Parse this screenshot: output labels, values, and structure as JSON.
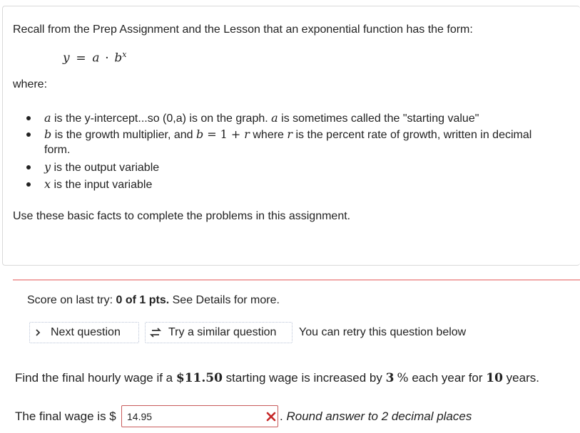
{
  "intro": {
    "recall_text": "Recall from the Prep Assignment and the Lesson that an exponential function has the form:",
    "formula": {
      "lhs": "y",
      "eq": "=",
      "a": "a",
      "dot": "·",
      "b": "b",
      "exp": "x"
    },
    "where_label": "where:",
    "bullets": [
      {
        "var": "a",
        "text": " is the y-intercept...so (0,a) is on the graph. ",
        "var2": "a",
        "text2": " is sometimes called the \"starting value\""
      },
      {
        "var": "b",
        "text": " is the growth multiplier, and ",
        "eq_b": "b",
        "eq_eq": "=",
        "eq_one": "1",
        "eq_plus": "+",
        "eq_r": "r",
        "text2": " where ",
        "r": "r",
        "text3": " is the percent rate of growth, written in decimal",
        "text4": "form."
      },
      {
        "var": "y",
        "text": " is the output variable"
      },
      {
        "var": "x",
        "text": " is the input variable"
      }
    ],
    "use_text": "Use these basic facts to complete the problems in this assignment."
  },
  "score": {
    "prefix": "Score on last try: ",
    "value": "0 of 1 pts.",
    "suffix": " See Details for more."
  },
  "buttons": {
    "next_label": "Next question",
    "similar_label": "Try a similar question",
    "retry_note": "You can retry this question below"
  },
  "question": {
    "p1": "Find the final hourly wage if a ",
    "amount": "$11.50",
    "p2": " starting wage is increased by ",
    "rate": "3",
    "rate_unit": "%",
    "p3": " each year for ",
    "years": "10",
    "p4": " years."
  },
  "answer": {
    "label": "The final wage is $",
    "value": "14.95",
    "status": "incorrect",
    "hint": "Round answer to 2 decimal places",
    "hint_prefix": "."
  },
  "colors": {
    "error": "#c62828",
    "divider": "#f1a7a7",
    "input_border": "#c85b5b"
  }
}
